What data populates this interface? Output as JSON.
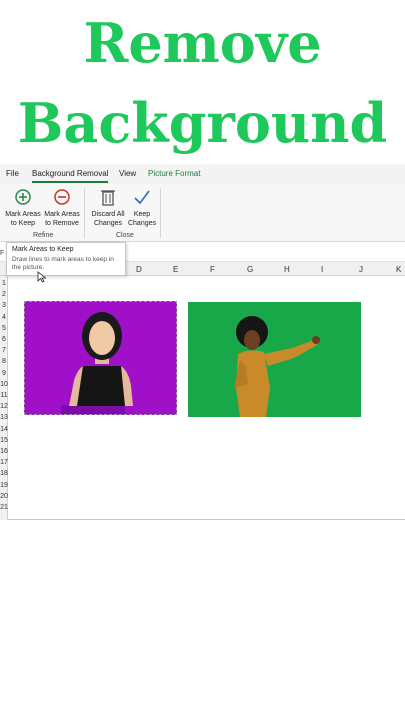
{
  "headline": {
    "line1": "Remove",
    "line2": "Background"
  },
  "menu": {
    "file": "File",
    "background_removal": "Background Removal",
    "view": "View",
    "picture_format": "Picture Format"
  },
  "ribbon": {
    "mark_keep_1": "Mark Areas",
    "mark_keep_2": "to Keep",
    "mark_remove_1": "Mark Areas",
    "mark_remove_2": "to Remove",
    "discard_1": "Discard All",
    "discard_2": "Changes",
    "keep_changes_1": "Keep",
    "keep_changes_2": "Changes",
    "group_refine": "Refine",
    "group_close": "Close"
  },
  "formula_bar": {
    "name_box_partial": "F"
  },
  "tooltip": {
    "title": "Mark Areas to Keep",
    "body_1": "Draw lines to mark areas to keep in",
    "body_2": "the picture."
  },
  "columns": [
    "D",
    "E",
    "F",
    "G",
    "H",
    "I",
    "J",
    "K"
  ],
  "rows": [
    "1",
    "2",
    "3",
    "4",
    "5",
    "6",
    "7",
    "8",
    "9",
    "10",
    "11",
    "12",
    "13",
    "14",
    "15",
    "16",
    "17",
    "18",
    "19",
    "20",
    "21"
  ],
  "colors": {
    "headline": "#1fc85a",
    "accent": "#1e7a3c",
    "photo1_bg": "#a010c8",
    "photo2_bg": "#18a84a"
  }
}
